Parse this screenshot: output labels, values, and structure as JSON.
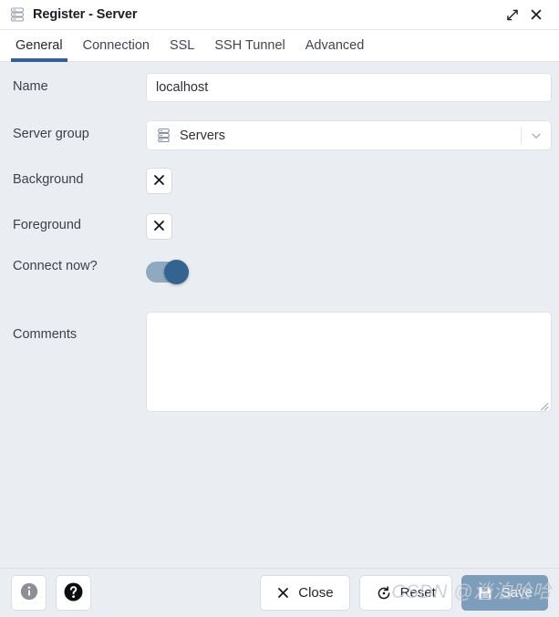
{
  "window": {
    "title": "Register - Server",
    "title_icon": "server-stack-icon",
    "expand_icon": "expand-diagonal-icon",
    "close_icon": "close-x-icon"
  },
  "tabs": [
    {
      "label": "General",
      "active": true
    },
    {
      "label": "Connection",
      "active": false
    },
    {
      "label": "SSL",
      "active": false
    },
    {
      "label": "SSH Tunnel",
      "active": false
    },
    {
      "label": "Advanced",
      "active": false
    }
  ],
  "form": {
    "name": {
      "label": "Name",
      "value": "localhost",
      "placeholder": ""
    },
    "server_group": {
      "label": "Server group",
      "value": "Servers",
      "icon": "server-group-icon",
      "caret_icon": "chevron-down-icon"
    },
    "background": {
      "label": "Background",
      "clear_icon": "close-x-icon"
    },
    "foreground": {
      "label": "Foreground",
      "clear_icon": "close-x-icon"
    },
    "connect_now": {
      "label": "Connect now?",
      "state": "on"
    },
    "comments": {
      "label": "Comments",
      "value": "",
      "placeholder": ""
    }
  },
  "footer": {
    "info_label": "",
    "info_icon": "info-circle-icon",
    "help_label": "",
    "help_icon": "help-circle-icon",
    "close_label": "Close",
    "close_icon": "close-x-icon",
    "reset_label": "Reset",
    "reset_icon": "reset-circular-arrow-icon",
    "save_label": "Save",
    "save_icon": "save-floppy-icon"
  },
  "watermark": {
    "text": "CSDN @淡泊哈哈"
  },
  "colors": {
    "accent": "#346094",
    "toggle_track": "#8fa9c0",
    "toggle_knob": "#33648f",
    "save_button": "#7d9dba",
    "body_background": "#eaedf2"
  }
}
